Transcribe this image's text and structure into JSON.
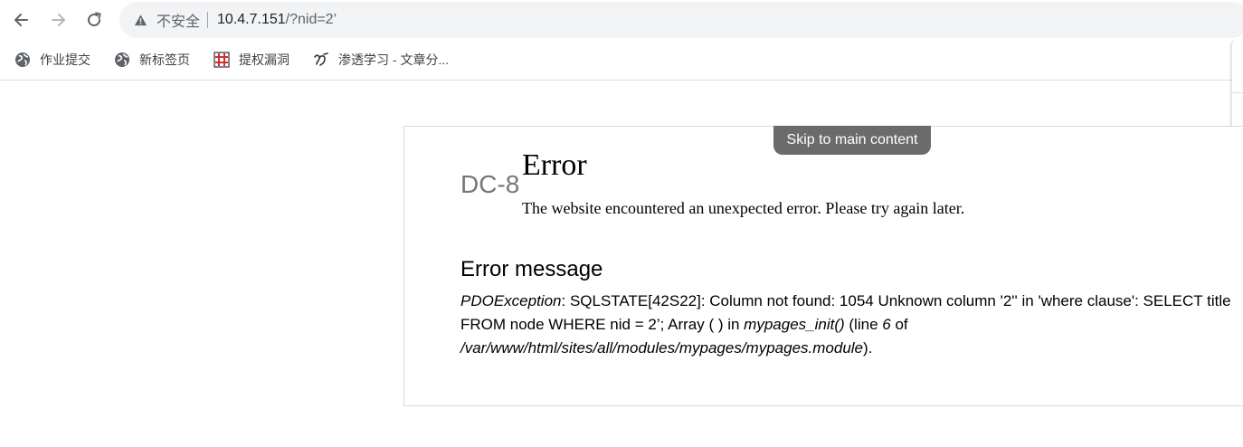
{
  "browser": {
    "insecure_label": "不安全",
    "url_host": "10.4.7.151",
    "url_path": "/?nid=2’"
  },
  "bookmarks": [
    {
      "label": "作业提交",
      "icon": "globe-icon"
    },
    {
      "label": "新标签页",
      "icon": "globe-icon"
    },
    {
      "label": "提权漏洞",
      "icon": "red-grid-icon"
    },
    {
      "label": "渗透学习 - 文章分...",
      "icon": "swirl-icon"
    }
  ],
  "page": {
    "skip_link": "Skip to main content",
    "site_name": "DC-8",
    "error_title": "Error",
    "error_description": "The website encountered an unexpected error. Please try again later.",
    "message_heading": "Error message",
    "message": {
      "exception": "PDOException",
      "text1": ": SQLSTATE[42S22]: Column not found: 1054 Unknown column '2'' in 'where clause': SELECT title FROM node WHERE nid = 2’; Array ( ) in ",
      "function": "mypages_init()",
      "text2": " (line ",
      "line": "6",
      "text3": " of ",
      "file": "/var/www/html/sites/all/modules/mypages/mypages.module",
      "text4": ")."
    }
  }
}
